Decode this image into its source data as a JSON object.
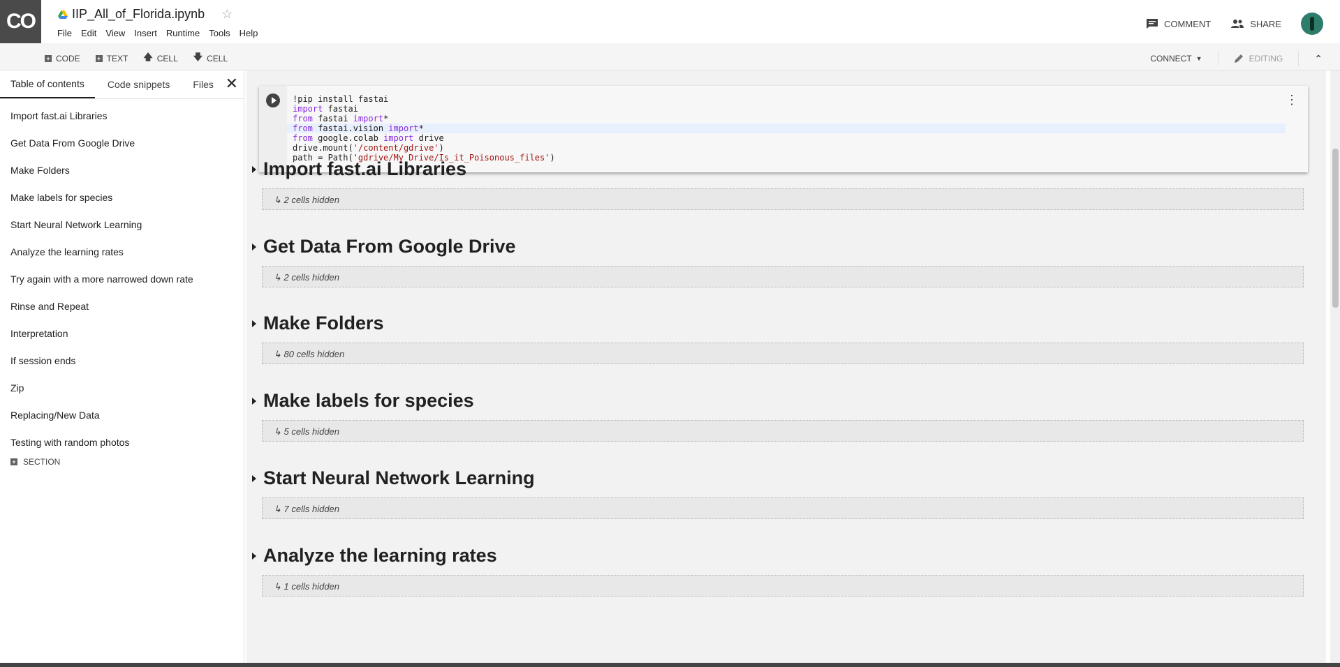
{
  "app": {
    "logo": "CO",
    "doc_title": "IIP_All_of_Florida.ipynb"
  },
  "menu": [
    "File",
    "Edit",
    "View",
    "Insert",
    "Runtime",
    "Tools",
    "Help"
  ],
  "header_right": {
    "comment": "COMMENT",
    "share": "SHARE"
  },
  "toolbar": {
    "code": "CODE",
    "text": "TEXT",
    "cell_up": "CELL",
    "cell_down": "CELL",
    "connect": "CONNECT",
    "editing": "EDITING"
  },
  "sidebar": {
    "tabs": [
      "Table of contents",
      "Code snippets",
      "Files"
    ],
    "items": [
      "Import fast.ai Libraries",
      "Get Data From Google Drive",
      "Make Folders",
      "Make labels for species",
      "Start Neural Network Learning",
      "Analyze the learning rates",
      "Try again with a more narrowed down rate",
      "Rinse and Repeat",
      "Interpretation",
      "If session ends",
      "Zip",
      "Replacing/New Data",
      "Testing with random photos"
    ],
    "add_section": "SECTION"
  },
  "code_cell": {
    "lines": [
      "!pip install fastai",
      "import fastai",
      "from fastai import*",
      "from fastai.vision import*",
      "from google.colab import drive",
      "drive.mount('/content/gdrive')",
      "path = Path('gdrive/My Drive/Is_it_Poisonous_files')"
    ]
  },
  "sections": [
    {
      "title": "Import fast.ai Libraries",
      "hidden": "2 cells hidden"
    },
    {
      "title": "Get Data From Google Drive",
      "hidden": "2 cells hidden"
    },
    {
      "title": "Make Folders",
      "hidden": "80 cells hidden"
    },
    {
      "title": "Make labels for species",
      "hidden": "5 cells hidden"
    },
    {
      "title": "Start Neural Network Learning",
      "hidden": "7 cells hidden"
    },
    {
      "title": "Analyze the learning rates",
      "hidden": "1 cells hidden"
    }
  ],
  "colors": {
    "logo_bg": "#4a4a4a",
    "toolbar_bg": "#f5f5f5",
    "main_bg": "#f2f2f2",
    "hidden_box": "#e8e8e8"
  }
}
